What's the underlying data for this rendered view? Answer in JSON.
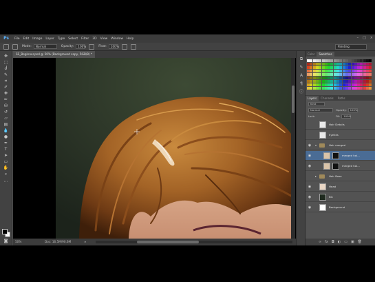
{
  "app": {
    "logo": "Ps",
    "menu": [
      "File",
      "Edit",
      "Image",
      "Layer",
      "Type",
      "Select",
      "Filter",
      "3D",
      "View",
      "Window",
      "Help"
    ],
    "window_controls": [
      "–",
      "□",
      "×"
    ]
  },
  "options": {
    "mode_label": "Mode:",
    "mode_value": "Normal",
    "opacity_label": "Opacity:",
    "opacity_value": "100%",
    "flow_label": "Flow:",
    "flow_value": "100%",
    "workspace": "Painting"
  },
  "document": {
    "tab_title": "SS_Beginner.psd @ 50% (Background copy, RGB/8) *",
    "zoom": "50%",
    "doc_size": "Doc: 16.5M/90.6M"
  },
  "panels": {
    "swatches_tabs": [
      "Color",
      "Swatches"
    ],
    "layers_tabs": [
      "Layers",
      "Channels",
      "Paths"
    ],
    "kind_label": "Kind",
    "blend_mode": "Normal",
    "opacity_label": "Opacity:",
    "opacity_value": "100%",
    "lock_label": "Lock:",
    "fill_label": "Fill:",
    "fill_value": "100%",
    "layers": [
      {
        "name": "Hair Details"
      },
      {
        "name": "Eyelids"
      },
      {
        "name": "Hair merged"
      },
      {
        "name": "merged hai..."
      },
      {
        "name": "merged hai..."
      },
      {
        "name": "Hair Base"
      },
      {
        "name": "Head"
      },
      {
        "name": "BG"
      },
      {
        "name": "Background"
      }
    ],
    "footer_icons": [
      "∞",
      "fx",
      "◘",
      "◐",
      "▭",
      "▣",
      "🗑"
    ]
  },
  "colors": {
    "accent": "#4a6c95",
    "panel_bg": "#535353",
    "chrome": "#424242"
  }
}
